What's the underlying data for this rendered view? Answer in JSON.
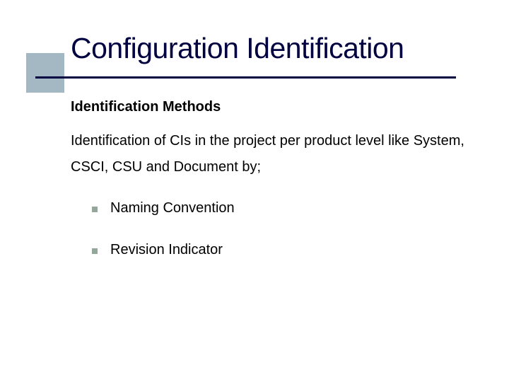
{
  "slide": {
    "title": "Configuration Identification",
    "subheading": "Identification Methods",
    "body": "Identification of CIs in the project per product level like System, CSCI, CSU and Document by;",
    "bullets": [
      "Naming Convention",
      "Revision Indicator"
    ]
  }
}
